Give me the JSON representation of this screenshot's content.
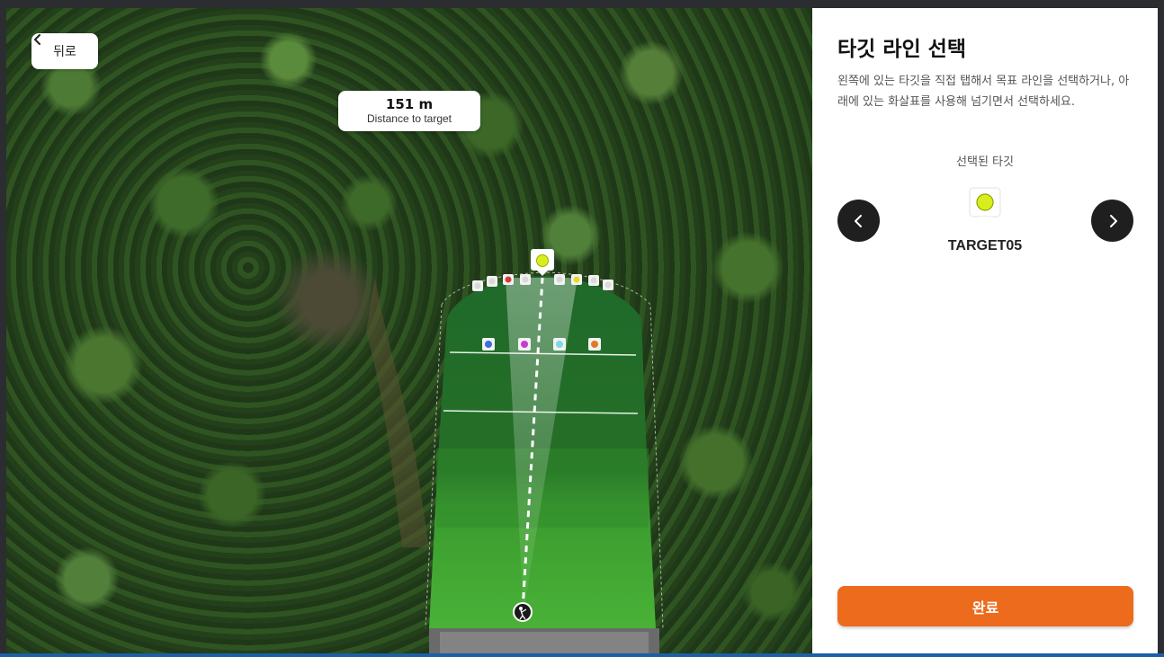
{
  "back_button": {
    "label": "뒤로",
    "icon": "chevron-left-icon"
  },
  "distance": {
    "value": "151 m",
    "label": "Distance to target"
  },
  "panel": {
    "title": "타깃 라인 선택",
    "description": "왼쪽에 있는 타깃을 직접 탭해서 목표 라인을 선택하거나, 아래에 있는 화살표를 사용해 넘기면서 선택하세요.",
    "selected_label": "선택된 타깃",
    "selected_target": "TARGET05",
    "selected_color": "#d7ee1c",
    "prev_icon": "chevron-left-icon",
    "next_icon": "chevron-right-icon",
    "done_label": "완료"
  },
  "colors": {
    "accent": "#ec6b1c",
    "nav_button": "#1f1f1f",
    "fairway": "#2f8a2c"
  },
  "map": {
    "selected_target_color": "#d7ee1c",
    "far_targets": [
      "#d9d9d9",
      "#d9d9d9",
      "#d33b3b",
      "#d9d9d9",
      "#d9d9d9",
      "#e9d72a",
      "#d9d9d9",
      "#d9d9d9"
    ],
    "mid_targets": [
      "#3f6fd6",
      "#c93bd0",
      "#7fd8e0",
      "#e07a2a"
    ],
    "tee_icon": "golfer-icon"
  }
}
